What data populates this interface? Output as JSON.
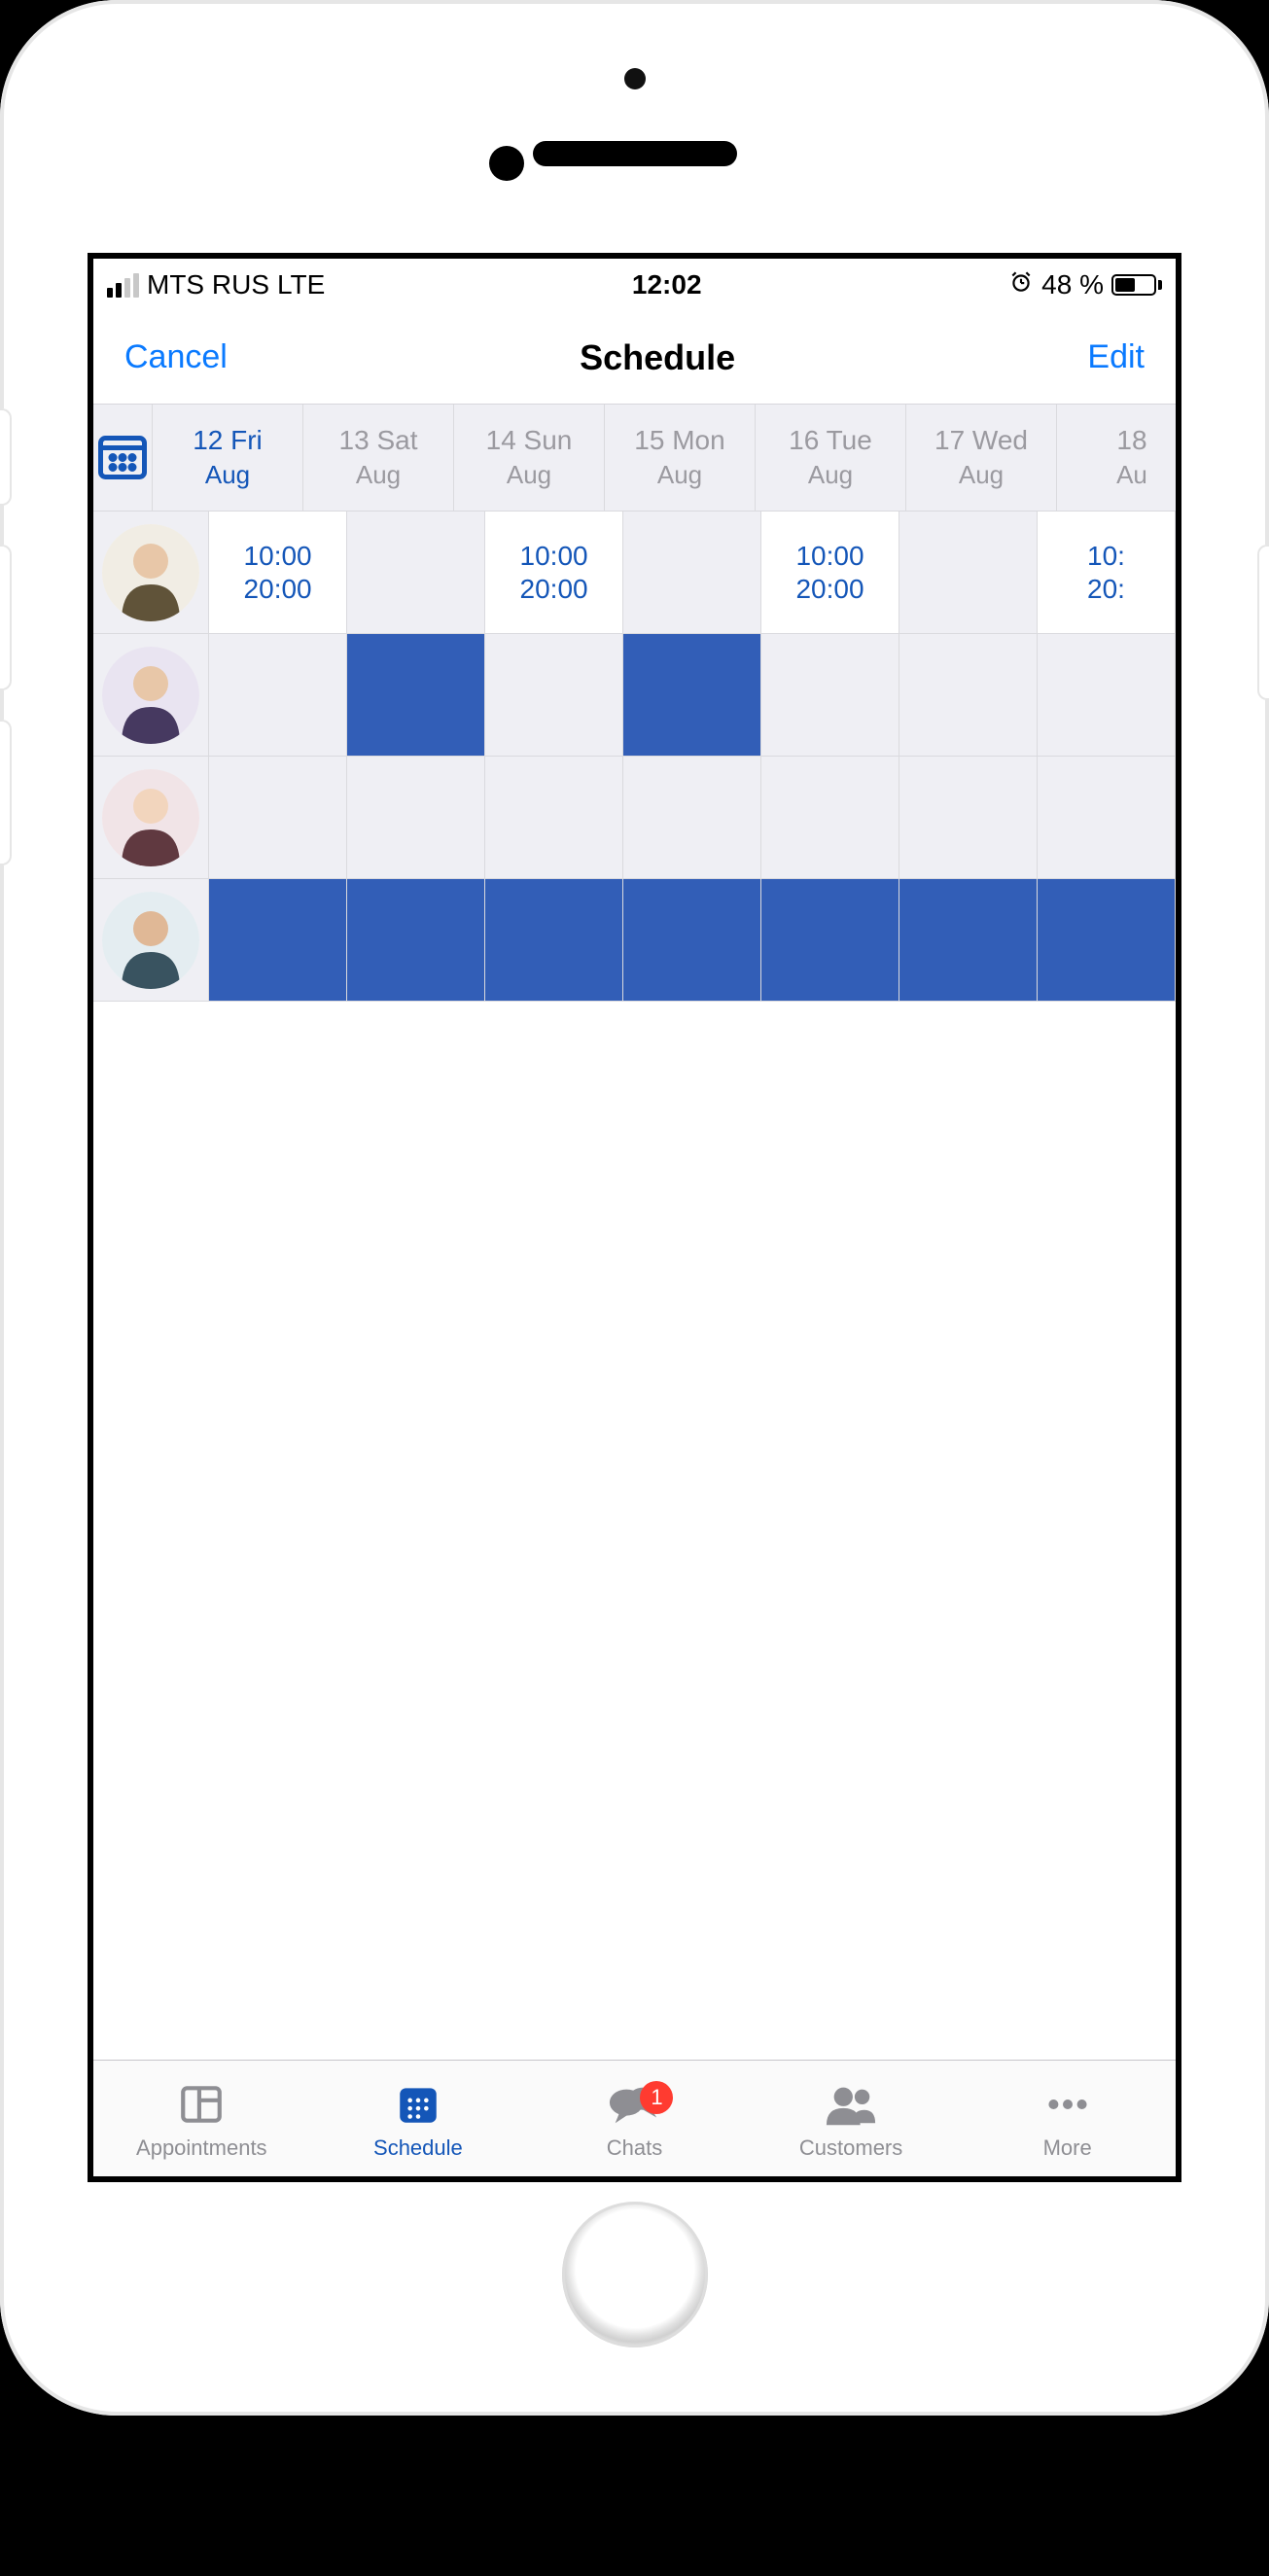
{
  "statusBar": {
    "carrier": "MTS RUS",
    "network": "LTE",
    "time": "12:02",
    "alarm": true,
    "batteryPercent": "48 %"
  },
  "navBar": {
    "left": "Cancel",
    "title": "Schedule",
    "right": "Edit"
  },
  "schedule": {
    "days": [
      {
        "label": "12 Fri",
        "month": "Aug",
        "active": true
      },
      {
        "label": "13 Sat",
        "month": "Aug",
        "active": false
      },
      {
        "label": "14 Sun",
        "month": "Aug",
        "active": false
      },
      {
        "label": "15 Mon",
        "month": "Aug",
        "active": false
      },
      {
        "label": "16 Tue",
        "month": "Aug",
        "active": false
      },
      {
        "label": "17 Wed",
        "month": "Aug",
        "active": false
      },
      {
        "label": "18",
        "month": "Au",
        "active": false
      }
    ],
    "staff": [
      {
        "id": "staff-1",
        "cells": [
          {
            "type": "times",
            "start": "10:00",
            "end": "20:00"
          },
          {
            "type": "empty"
          },
          {
            "type": "times",
            "start": "10:00",
            "end": "20:00"
          },
          {
            "type": "empty"
          },
          {
            "type": "times",
            "start": "10:00",
            "end": "20:00"
          },
          {
            "type": "empty"
          },
          {
            "type": "times",
            "start": "10:",
            "end": "20:"
          }
        ]
      },
      {
        "id": "staff-2",
        "cells": [
          {
            "type": "empty"
          },
          {
            "type": "blue"
          },
          {
            "type": "empty"
          },
          {
            "type": "blue"
          },
          {
            "type": "empty"
          },
          {
            "type": "empty"
          },
          {
            "type": "empty"
          }
        ]
      },
      {
        "id": "staff-3",
        "cells": [
          {
            "type": "empty"
          },
          {
            "type": "empty"
          },
          {
            "type": "empty"
          },
          {
            "type": "empty"
          },
          {
            "type": "empty"
          },
          {
            "type": "empty"
          },
          {
            "type": "empty"
          }
        ]
      },
      {
        "id": "staff-4",
        "cells": [
          {
            "type": "blue"
          },
          {
            "type": "blue"
          },
          {
            "type": "blue"
          },
          {
            "type": "blue"
          },
          {
            "type": "blue"
          },
          {
            "type": "blue"
          },
          {
            "type": "blue"
          }
        ]
      }
    ]
  },
  "tabs": {
    "items": [
      {
        "label": "Appointments",
        "icon": "appointments",
        "active": false,
        "badge": null
      },
      {
        "label": "Schedule",
        "icon": "schedule",
        "active": true,
        "badge": null
      },
      {
        "label": "Chats",
        "icon": "chats",
        "active": false,
        "badge": "1"
      },
      {
        "label": "Customers",
        "icon": "customers",
        "active": false,
        "badge": null
      },
      {
        "label": "More",
        "icon": "more",
        "active": false,
        "badge": null
      }
    ]
  }
}
